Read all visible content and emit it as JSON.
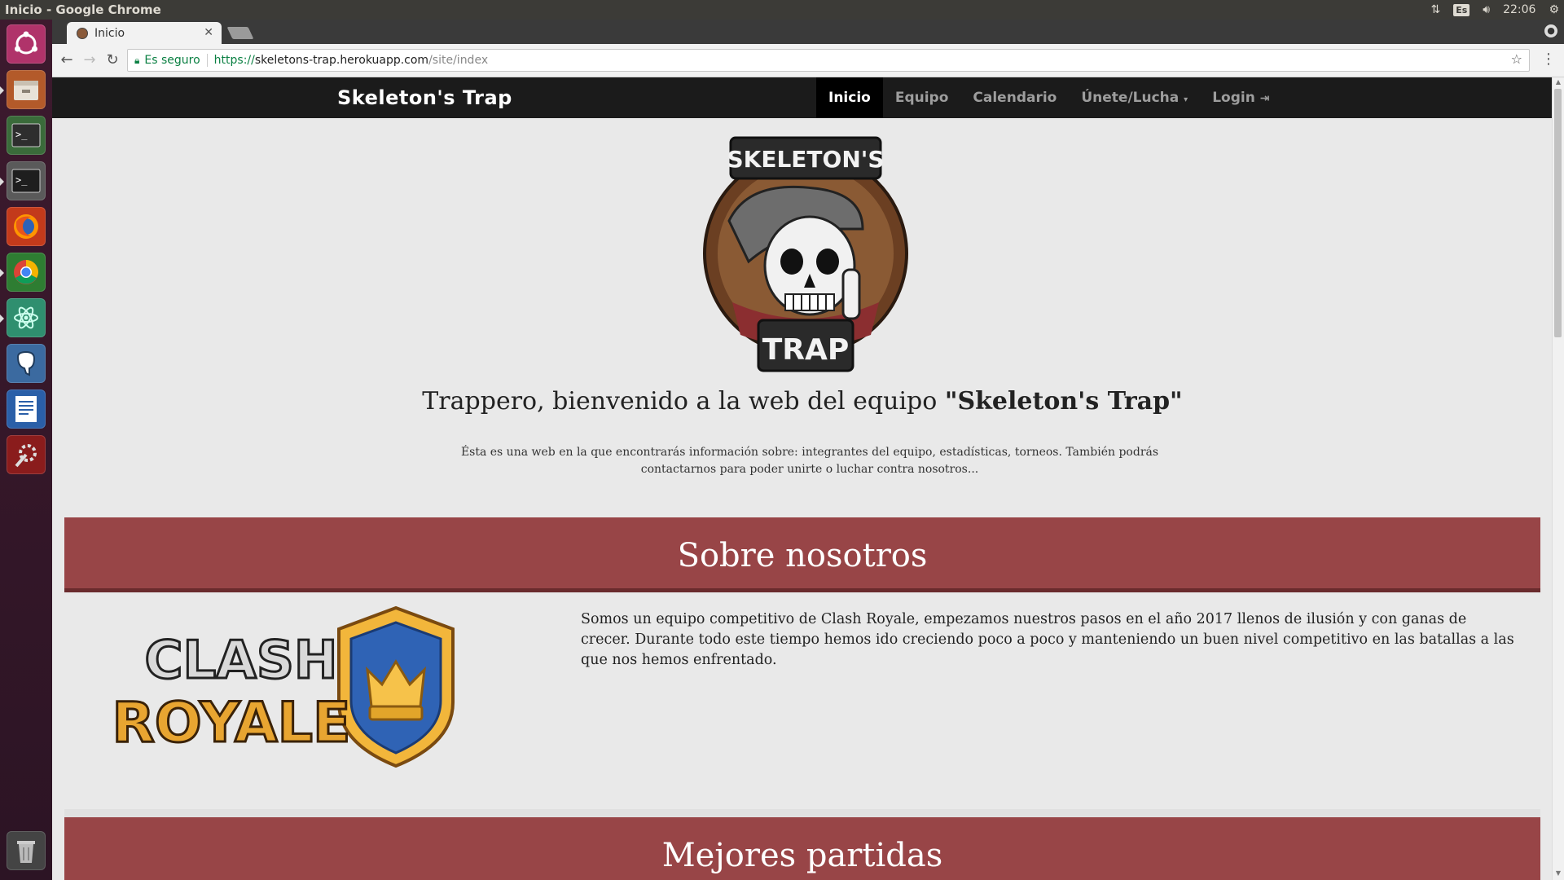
{
  "os": {
    "window_title": "Inicio - Google Chrome",
    "keyboard_layout": "Es",
    "clock": "22:06"
  },
  "launcher": {
    "items": [
      "ubuntu-dash",
      "files",
      "terminal",
      "terminal-2",
      "firefox",
      "chrome",
      "atom",
      "pgadmin",
      "libreoffice-writer",
      "system-settings",
      "trash"
    ]
  },
  "browser": {
    "tab_title": "Inicio",
    "secure_label": "Es seguro",
    "url_scheme": "https://",
    "url_host": "skeletons-trap.herokuapp.com",
    "url_path": "/site/index"
  },
  "site": {
    "brand": "Skeleton's Trap",
    "nav": {
      "inicio": "Inicio",
      "equipo": "Equipo",
      "calendario": "Calendario",
      "unete": "Únete/Lucha",
      "login": "Login"
    },
    "logo": {
      "top_text": "SKELETON'S",
      "bottom_text": "TRAP"
    },
    "welcome_prefix": "Trappero, bienvenido a la web del equipo ",
    "welcome_team": "\"Skeleton's Trap\"",
    "intro": "Ésta es una web en la que encontrarás información sobre: integrantes del equipo, estadísticas, torneos. También podrás contactarnos para poder unirte o luchar contra nosotros...",
    "about_title": "Sobre nosotros",
    "about_text": "Somos un equipo competitivo de Clash Royale, empezamos nuestros pasos en el año 2017 llenos de ilusión y con ganas de crecer. Durante todo este tiempo hemos ido creciendo poco a poco y manteniendo un buen nivel competitivo en las batallas a las que nos hemos enfrentado.",
    "cr_logo": {
      "line1": "CLASH",
      "line2": "ROYALE"
    },
    "best_games_title": "Mejores partidas"
  },
  "colors": {
    "banner": "#984547",
    "navbar": "#1b1b1b",
    "page_bg": "#e9e9e9"
  }
}
